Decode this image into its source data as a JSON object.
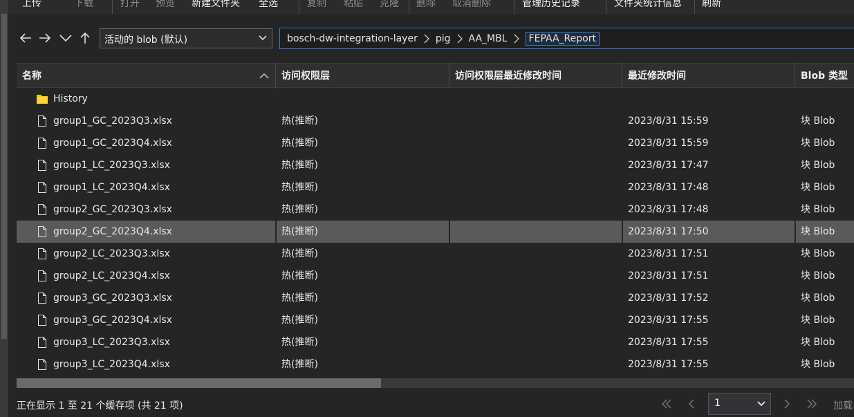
{
  "toolbar": {
    "upload": "上传",
    "download": "下载",
    "open": "打开",
    "preview": "预览",
    "new_folder": "新建文件夹",
    "select_all": "全选",
    "copy": "复制",
    "paste": "粘贴",
    "clone": "克隆",
    "delete": "删除",
    "undelete": "取消删除",
    "manage_history": "管理历史记录",
    "folder_stats": "文件夹统计信息",
    "refresh": "刷新"
  },
  "nav": {
    "blob_view": "活动的 blob (默认)",
    "breadcrumb": [
      "bosch-dw-integration-layer",
      "pig",
      "AA_MBL",
      "FEPAA_Report"
    ]
  },
  "table": {
    "columns": {
      "name": "名称",
      "access_tier": "访问权限层",
      "tier_modified": "访问权限层最近修改时间",
      "last_modified": "最近修改时间",
      "blob_type": "Blob 类型"
    },
    "rows": [
      {
        "type": "folder",
        "name": "History",
        "tier": "",
        "tier_modified": "",
        "modified": "",
        "blob_type": ""
      },
      {
        "type": "file",
        "name": "group1_GC_2023Q3.xlsx",
        "tier": "热(推断)",
        "tier_modified": "",
        "modified": "2023/8/31 15:59",
        "blob_type": "块 Blob"
      },
      {
        "type": "file",
        "name": "group1_GC_2023Q4.xlsx",
        "tier": "热(推断)",
        "tier_modified": "",
        "modified": "2023/8/31 15:59",
        "blob_type": "块 Blob"
      },
      {
        "type": "file",
        "name": "group1_LC_2023Q3.xlsx",
        "tier": "热(推断)",
        "tier_modified": "",
        "modified": "2023/8/31 17:47",
        "blob_type": "块 Blob"
      },
      {
        "type": "file",
        "name": "group1_LC_2023Q4.xlsx",
        "tier": "热(推断)",
        "tier_modified": "",
        "modified": "2023/8/31 17:48",
        "blob_type": "块 Blob"
      },
      {
        "type": "file",
        "name": "group2_GC_2023Q3.xlsx",
        "tier": "热(推断)",
        "tier_modified": "",
        "modified": "2023/8/31 17:48",
        "blob_type": "块 Blob"
      },
      {
        "type": "file",
        "name": "group2_GC_2023Q4.xlsx",
        "tier": "热(推断)",
        "tier_modified": "",
        "modified": "2023/8/31 17:50",
        "blob_type": "块 Blob",
        "selected": true
      },
      {
        "type": "file",
        "name": "group2_LC_2023Q3.xlsx",
        "tier": "热(推断)",
        "tier_modified": "",
        "modified": "2023/8/31 17:51",
        "blob_type": "块 Blob"
      },
      {
        "type": "file",
        "name": "group2_LC_2023Q4.xlsx",
        "tier": "热(推断)",
        "tier_modified": "",
        "modified": "2023/8/31 17:51",
        "blob_type": "块 Blob"
      },
      {
        "type": "file",
        "name": "group3_GC_2023Q3.xlsx",
        "tier": "热(推断)",
        "tier_modified": "",
        "modified": "2023/8/31 17:52",
        "blob_type": "块 Blob"
      },
      {
        "type": "file",
        "name": "group3_GC_2023Q4.xlsx",
        "tier": "热(推断)",
        "tier_modified": "",
        "modified": "2023/8/31 17:55",
        "blob_type": "块 Blob"
      },
      {
        "type": "file",
        "name": "group3_LC_2023Q3.xlsx",
        "tier": "热(推断)",
        "tier_modified": "",
        "modified": "2023/8/31 17:55",
        "blob_type": "块 Blob"
      },
      {
        "type": "file",
        "name": "group3_LC_2023Q4.xlsx",
        "tier": "热(推断)",
        "tier_modified": "",
        "modified": "2023/8/31 17:55",
        "blob_type": "块 Blob"
      }
    ]
  },
  "status": {
    "text": "正在显示 1 至 21 个缓存项 (共 21 项)",
    "page": "1",
    "load_more": "加载"
  },
  "colors": {
    "background": "#252526",
    "selected_row": "#5f5f5f",
    "folder": "#f5c518",
    "accent_border": "#3a7bd5"
  }
}
